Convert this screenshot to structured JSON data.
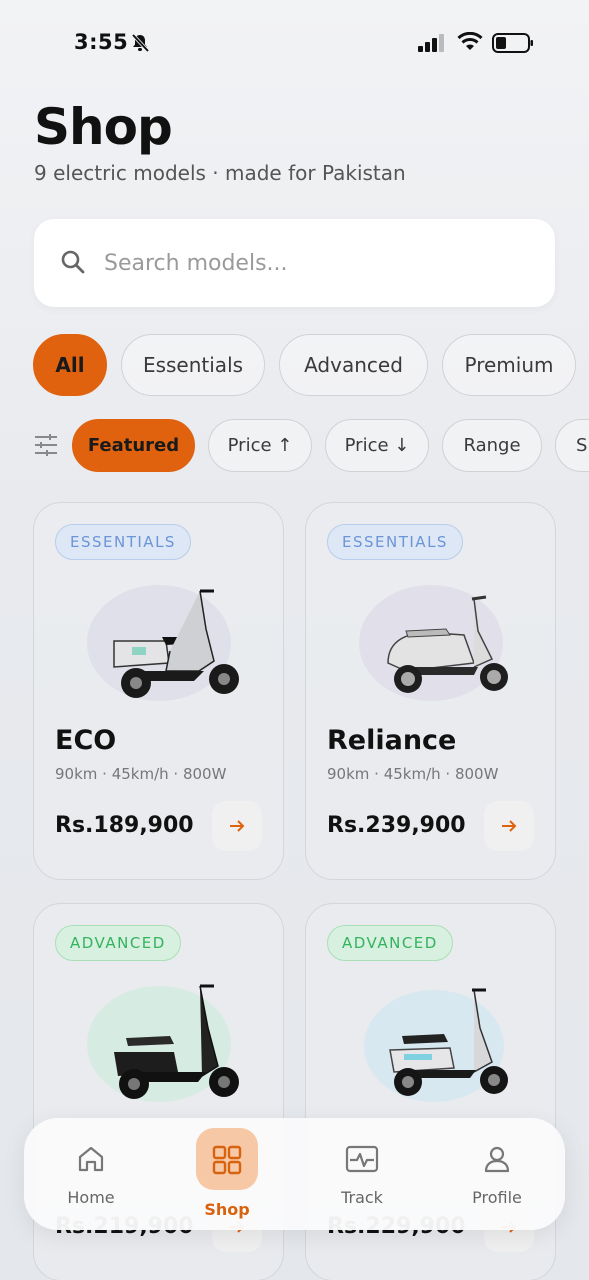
{
  "status": {
    "time": "3:55"
  },
  "header": {
    "title": "Shop",
    "subtitle": "9 electric models · made for Pakistan"
  },
  "search": {
    "placeholder": "Search models...",
    "value": ""
  },
  "categories": [
    "All",
    "Essentials",
    "Advanced",
    "Premium"
  ],
  "sort_options": [
    "Featured",
    "Price ↑",
    "Price ↓",
    "Range",
    "S"
  ],
  "products": [
    {
      "tier": "ESSENTIALS",
      "name": "ECO",
      "specs": "90km · 45km/h · 800W",
      "price": "Rs.189,900"
    },
    {
      "tier": "ESSENTIALS",
      "name": "Reliance",
      "specs": "90km · 45km/h · 800W",
      "price": "Rs.239,900"
    },
    {
      "tier": "ADVANCED",
      "name": "",
      "specs": "",
      "price": "Rs.219,900"
    },
    {
      "tier": "ADVANCED",
      "name": "",
      "specs": "",
      "price": "Rs.229,900"
    }
  ],
  "nav": {
    "home": "Home",
    "shop": "Shop",
    "track": "Track",
    "profile": "Profile"
  },
  "colors": {
    "accent": "#e0620f",
    "essentials_badge": "#6b95d8",
    "advanced_badge": "#33b35d"
  }
}
